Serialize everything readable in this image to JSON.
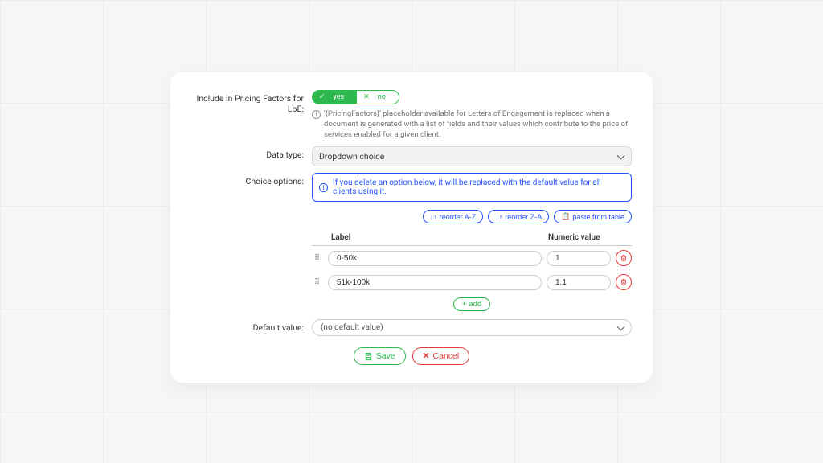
{
  "labels": {
    "includeInPricing": "Include in Pricing Factors for LoE:",
    "dataType": "Data type:",
    "choiceOptions": "Choice options:",
    "defaultValue": "Default value:"
  },
  "toggle": {
    "yes": "yes",
    "no": "no"
  },
  "helpText": "'{PricingFactors}' placeholder available for Letters of Engagement is replaced when a document is generated with a list of fields and their values which contribute to the price of services enabled for a given client.",
  "dataTypeSelected": "Dropdown choice",
  "banner": "If you delete an option below, it will be replaced with the default value for all clients using it.",
  "pills": {
    "reorderAZ": "reorder A-Z",
    "reorderZA": "reorder Z-A",
    "paste": "paste from table"
  },
  "tableHeader": {
    "label": "Label",
    "numeric": "Numeric value"
  },
  "options": [
    {
      "label": "0-50k",
      "value": "1"
    },
    {
      "label": "51k-100k",
      "value": "1.1"
    }
  ],
  "addLabel": "add",
  "defaultValuePlaceholder": "(no default value)",
  "buttons": {
    "save": "Save",
    "cancel": "Cancel"
  }
}
